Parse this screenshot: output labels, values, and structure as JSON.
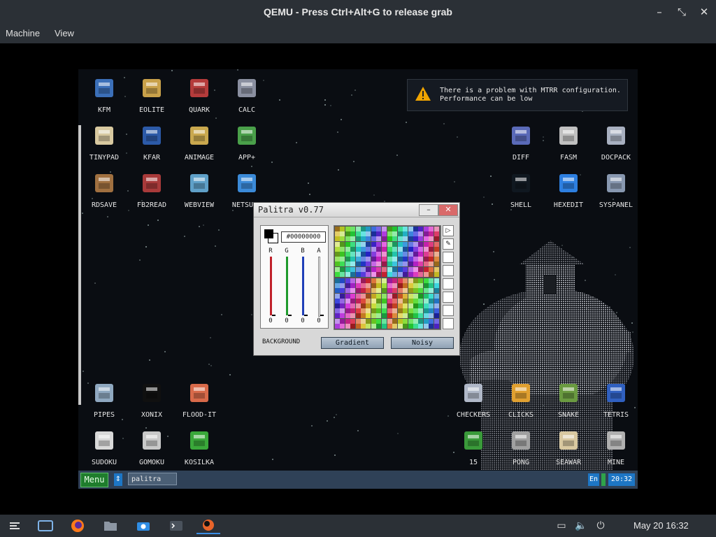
{
  "host_window": {
    "title": "QEMU - Press Ctrl+Alt+G to release grab",
    "menu": [
      "Machine",
      "View"
    ],
    "controls": {
      "minimize": "–",
      "restore": "⤡",
      "close": "✕"
    }
  },
  "desktop_icons": [
    {
      "label": "KFM",
      "icon": "floppy-icon"
    },
    {
      "label": "EOLITE",
      "icon": "folder-icon"
    },
    {
      "label": "QUARK",
      "icon": "notebook-icon"
    },
    {
      "label": "CALC",
      "icon": "calculator-icon"
    },
    {
      "label": "TINYPAD",
      "icon": "notepad-icon"
    },
    {
      "label": "KFAR",
      "icon": "panels-icon"
    },
    {
      "label": "ANIMAGE",
      "icon": "pencil-icon"
    },
    {
      "label": "APP+",
      "icon": "cube-icon"
    },
    {
      "label": "RDSAVE",
      "icon": "save-icon"
    },
    {
      "label": "FB2READ",
      "icon": "book-icon"
    },
    {
      "label": "WEBVIEW",
      "icon": "globe-window-icon"
    },
    {
      "label": "NETSURF",
      "icon": "globe-icon"
    },
    {
      "label": "DIFF",
      "icon": "diff-icon"
    },
    {
      "label": "FASM",
      "icon": "fasm-icon"
    },
    {
      "label": "DOCPACK",
      "icon": "cabinet-icon"
    },
    {
      "label": "SHELL",
      "icon": "terminal-icon"
    },
    {
      "label": "HEXEDIT",
      "icon": "hex-icon"
    },
    {
      "label": "SYSPANEL",
      "icon": "sliders-icon"
    },
    {
      "label": "PIPES",
      "icon": "pipes-icon"
    },
    {
      "label": "XONIX",
      "icon": "xonix-icon"
    },
    {
      "label": "FLOOD-IT",
      "icon": "flood-icon"
    },
    {
      "label": "SUDOKU",
      "icon": "sudoku-icon"
    },
    {
      "label": "GOMOKU",
      "icon": "gomoku-icon"
    },
    {
      "label": "KOSILKA",
      "icon": "mower-icon"
    },
    {
      "label": "CHECKERS",
      "icon": "checkers-icon"
    },
    {
      "label": "CLICKS",
      "icon": "clicks-icon"
    },
    {
      "label": "SNAKE",
      "icon": "snake-icon"
    },
    {
      "label": "TETRIS",
      "icon": "tetris-icon"
    },
    {
      "label": "15",
      "icon": "fifteen-icon"
    },
    {
      "label": "PONG",
      "icon": "pong-icon"
    },
    {
      "label": "SEAWAR",
      "icon": "ship-icon"
    },
    {
      "label": "MINE",
      "icon": "mine-icon"
    }
  ],
  "notification": {
    "text": "There is a problem with MTRR configuration.\nPerformance can be low",
    "icon": "warning-icon"
  },
  "palitra": {
    "title": "Palitra v0.77",
    "minimize": "–",
    "close": "✕",
    "hex_value": "#00000000",
    "channels": [
      {
        "label": "R",
        "value": "0",
        "color": "#c0202a"
      },
      {
        "label": "G",
        "value": "0",
        "color": "#1f9a2c"
      },
      {
        "label": "B",
        "value": "0",
        "color": "#1f3fb8"
      },
      {
        "label": "A",
        "value": "0",
        "color": "#dcdcdc"
      }
    ],
    "background_label": "BACKGROUND",
    "gradient_button": "Gradient",
    "noisy_button": "Noisy",
    "tools": [
      "▷",
      "✎"
    ]
  },
  "guest_taskbar": {
    "menu_label": "Menu",
    "arrow": "⇕",
    "task_item": "palitra",
    "lang": "En",
    "clock": "20:32"
  },
  "host_taskbar": {
    "clock": "May 20  16:32"
  }
}
